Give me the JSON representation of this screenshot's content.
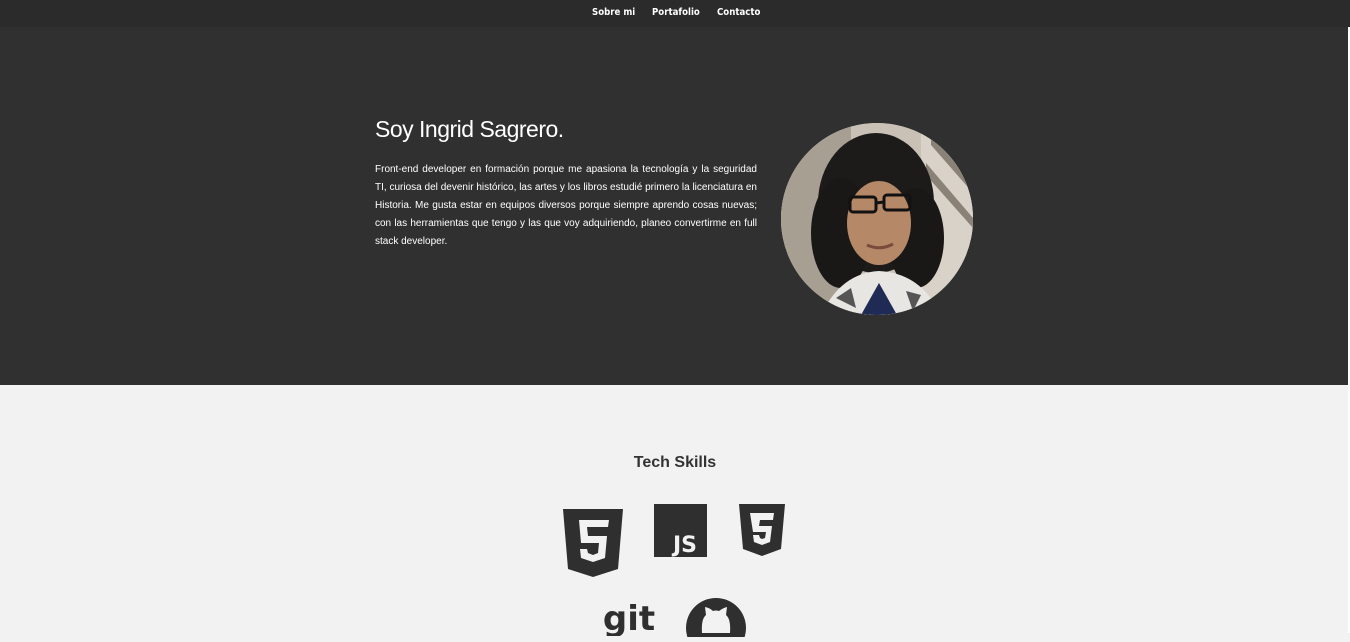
{
  "nav": {
    "items": [
      {
        "label": "Sobre mi"
      },
      {
        "label": "Portafolio"
      },
      {
        "label": "Contacto"
      }
    ]
  },
  "hero": {
    "title": "Soy Ingrid Sagrero.",
    "description": "Front-end developer en formación porque me apasiona la tecnología y la seguridad TI, curiosa del devenir histórico, las artes y los libros estudié primero la licenciatura en Historia. Me gusta estar en equipos diversos porque siempre aprendo cosas nuevas; con las herramientas que tengo y las que voy adquiriendo, planeo convertirme en full stack developer.",
    "photo_icon": "profile-photo"
  },
  "skills": {
    "title": "Tech Skills",
    "icons": [
      "html5-icon",
      "javascript-icon",
      "css3-icon",
      "git-icon",
      "github-icon"
    ],
    "js_label": "JS",
    "git_label": "git"
  },
  "colors": {
    "nav_bg": "#2b2b2b",
    "hero_bg": "#303030",
    "page_bg": "#f2f2f2",
    "icon": "#2f2f2f"
  }
}
